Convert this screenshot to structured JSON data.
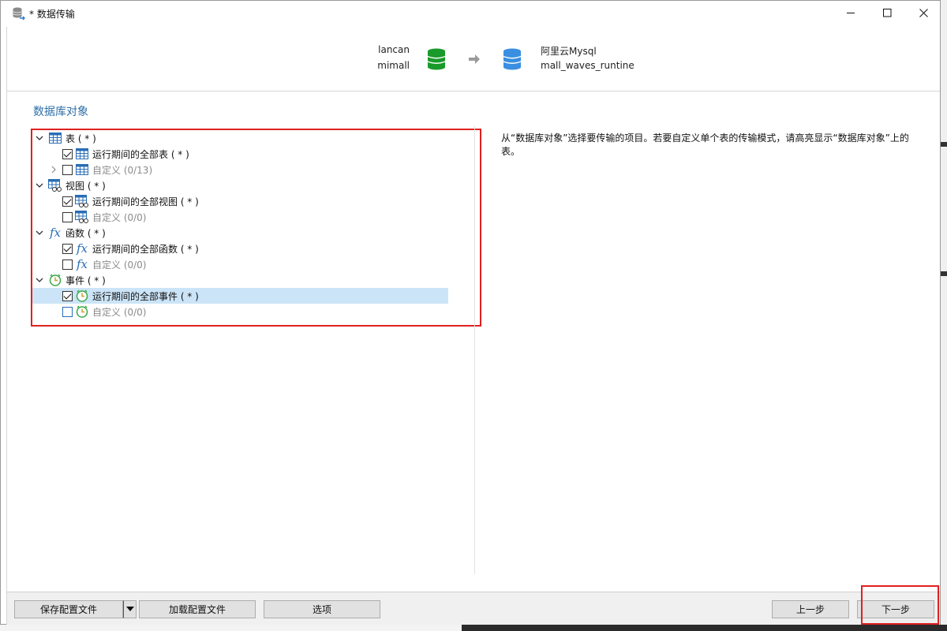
{
  "window": {
    "title": "* 数据传输"
  },
  "header": {
    "source": {
      "connection": "lancan",
      "database": "mimall",
      "color": "#1a9a2a"
    },
    "target": {
      "connection": "阿里云Mysql",
      "database": "mall_waves_runtine",
      "color": "#3a8fe0"
    }
  },
  "main": {
    "section_title": "数据库对象",
    "tree": [
      {
        "label": "表 ( * )",
        "icon": "table-icon",
        "expanded": true
      },
      {
        "label": "运行期间的全部表 ( * )",
        "icon": "table-icon",
        "checked": true
      },
      {
        "label": "自定义 (0/13)",
        "icon": "table-icon",
        "checked": false,
        "collapsed": true
      },
      {
        "label": "视图 ( * )",
        "icon": "view-icon",
        "expanded": true
      },
      {
        "label": "运行期间的全部视图 ( * )",
        "icon": "view-icon",
        "checked": true
      },
      {
        "label": "自定义 (0/0)",
        "icon": "view-icon",
        "checked": false
      },
      {
        "label": "函数 ( * )",
        "icon": "function-icon",
        "expanded": true
      },
      {
        "label": "运行期间的全部函数 ( * )",
        "icon": "function-icon",
        "checked": true
      },
      {
        "label": "自定义 (0/0)",
        "icon": "function-icon",
        "checked": false
      },
      {
        "label": "事件 ( * )",
        "icon": "event-icon",
        "expanded": true
      },
      {
        "label": "运行期间的全部事件 ( * )",
        "icon": "event-icon",
        "checked": true,
        "selected": true
      },
      {
        "label": "自定义 (0/0)",
        "icon": "event-icon",
        "checked": false
      }
    ],
    "description": "从“数据库对象”选择要传输的项目。若要自定义单个表的传输模式，请高亮显示“数据库对象”上的表。"
  },
  "footer": {
    "save_profile": "保存配置文件",
    "load_profile": "加载配置文件",
    "options": "选项",
    "back": "上一步",
    "next": "下一步"
  },
  "colors": {
    "accent": "#2e6fa7",
    "highlight_border": "#e02020",
    "selection": "#cce4f7"
  }
}
